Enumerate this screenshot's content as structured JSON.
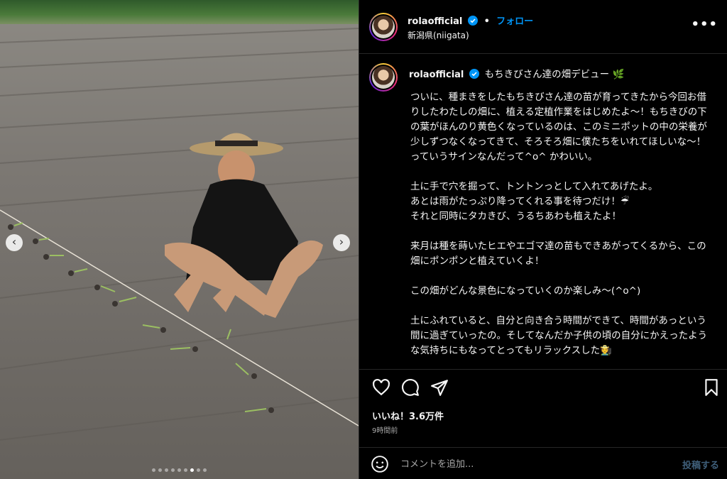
{
  "post": {
    "username": "rolaofficial",
    "follow_label": "フォロー",
    "separator": "•",
    "location": "新潟県(niigata)",
    "more_label": "•••",
    "caption_title": "もちきびさん達の畑デビュー 🌿",
    "caption_body": "ついに、種まきをしたもちきびさん達の苗が育ってきたから今回お借りしたわたしの畑に、植える定植作業をはじめたよ〜！もちきびの下の葉がほんのり黄色くなっているのは、このミニポットの中の栄養が少しずつなくなってきて、そろそろ畑に僕たちをいれてほしいな〜！っていうサインなんだって^o^ かわいい。\n\n土に手で穴を掘って、トントンっとして入れてあげたよ。\nあとは雨がたっぷり降ってくれる事を待つだけ！☔\nそれと同時にタカきび、うるちあわも植えたよ！\n\n来月は種を蒔いたヒエやエゴマ達の苗もできあがってくるから、この畑にポンポンと植えていくよ！\n\nこの畑がどんな景色になっていくのか楽しみ〜(^o^)\n\n土にふれていると、自分と向き合う時間ができて、時間があっという間に過ぎていったの。そしてなんだか子供の頃の自分にかえったような気持ちにもなってとってもリラックスした🧑‍🌾\n\nMillet Babies' First Day in the Field 🌿",
    "likes": "いいね！3.6万件",
    "time_ago": "9時間前",
    "comment_placeholder": "コメントを追加...",
    "post_label": "投稿する"
  },
  "media": {
    "prev_label": "‹",
    "next_label": "›",
    "slide_count": 9,
    "active_slide": 6
  },
  "icons": {
    "verified": "verified-badge-icon",
    "like": "heart-icon",
    "comment": "comment-icon",
    "share": "share-icon",
    "save": "bookmark-icon",
    "emoji": "emoji-icon"
  },
  "colors": {
    "background": "#000000",
    "accent": "#0095f6",
    "muted": "#a8a8a8",
    "post_disabled": "#3f5f7a"
  }
}
